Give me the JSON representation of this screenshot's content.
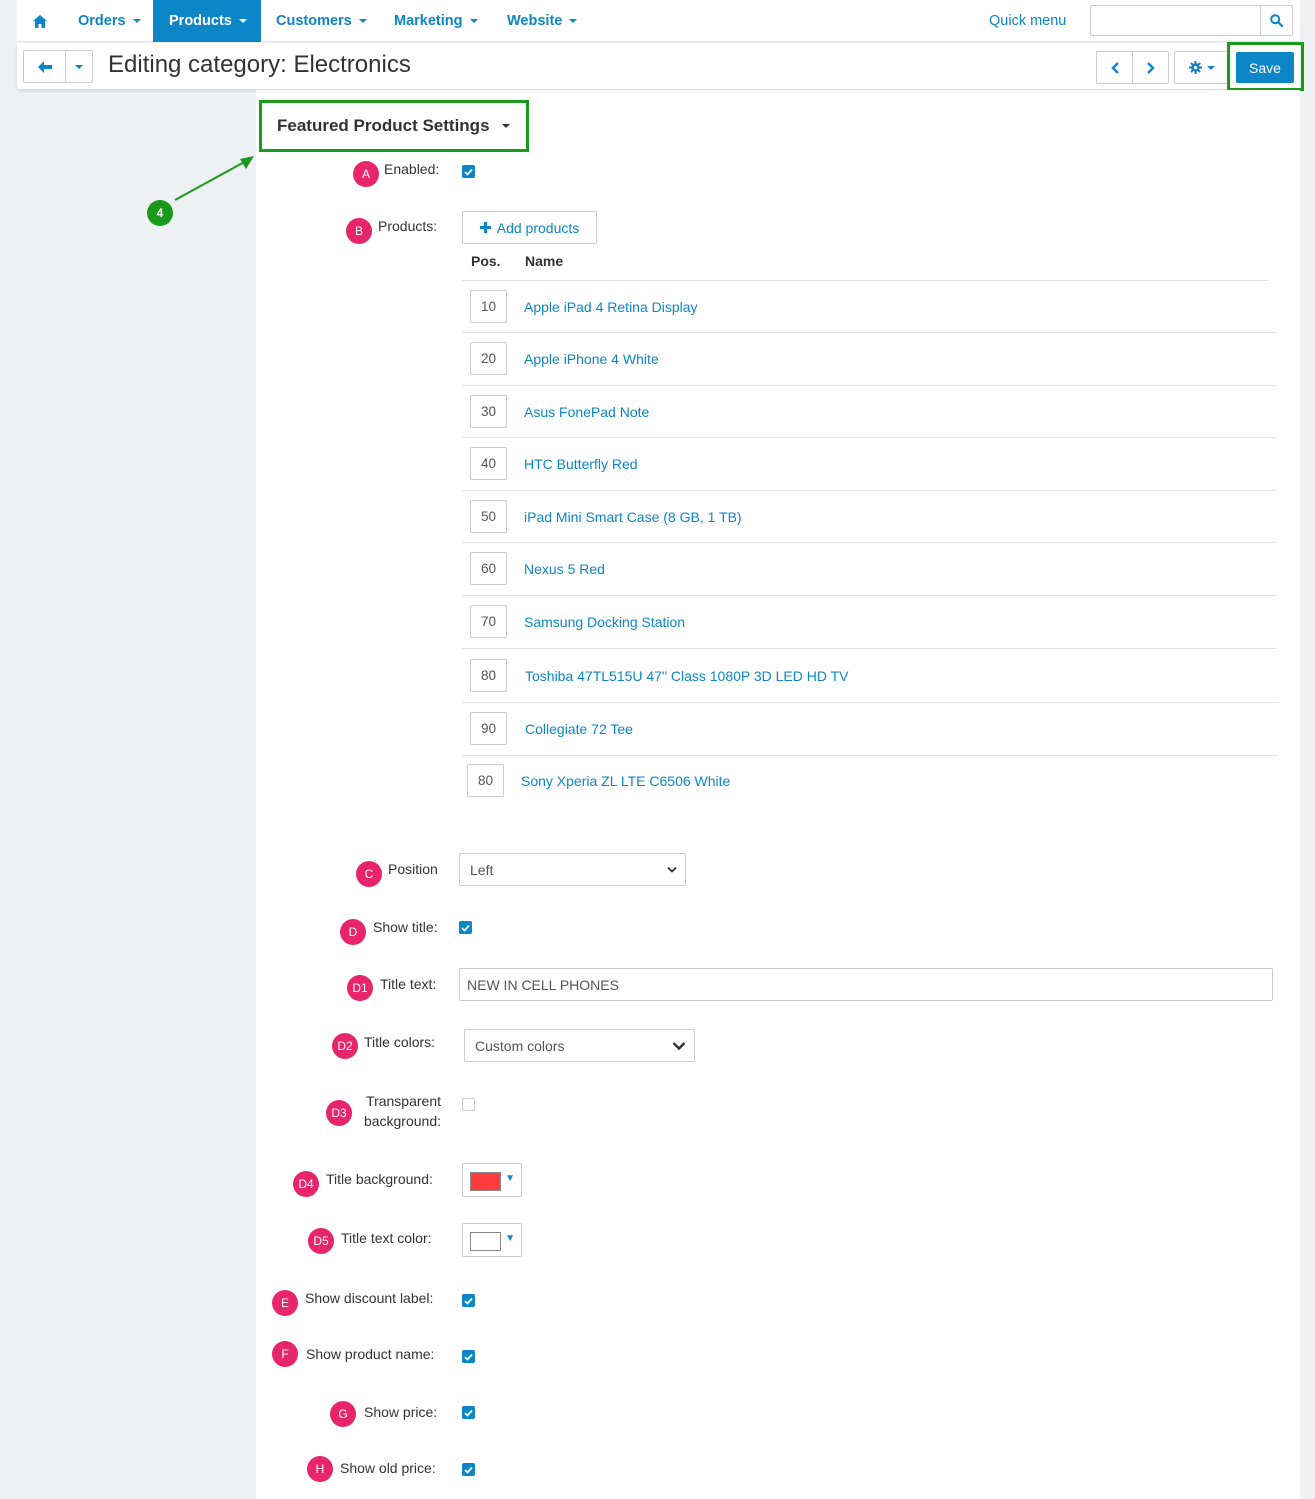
{
  "nav": {
    "items": [
      {
        "label": "Orders",
        "active": false
      },
      {
        "label": "Products",
        "active": true
      },
      {
        "label": "Customers",
        "active": false
      },
      {
        "label": "Marketing",
        "active": false
      },
      {
        "label": "Website",
        "active": false
      }
    ],
    "quick_menu": "Quick menu",
    "search_value": ""
  },
  "toolbar": {
    "title": "Editing category: Electronics",
    "save_label": "Save"
  },
  "section": {
    "title": "Featured Product Settings",
    "step_badge": "4"
  },
  "fields": {
    "enabled": {
      "badge": "A",
      "label": "Enabled:",
      "checked": true
    },
    "products": {
      "badge": "B",
      "label": "Products:",
      "add_label": "Add products"
    },
    "position": {
      "badge": "C",
      "label": "Position",
      "value": "Left"
    },
    "show_title": {
      "badge": "D",
      "label": "Show title:",
      "checked": true
    },
    "title_text": {
      "badge": "D1",
      "label": "Title text:",
      "value": "NEW IN CELL PHONES"
    },
    "title_colors": {
      "badge": "D2",
      "label": "Title colors:",
      "value": "Custom colors"
    },
    "transparent_bg": {
      "badge": "D3",
      "label_line1": "Transparent",
      "label_line2": "background:",
      "checked": false
    },
    "title_bg": {
      "badge": "D4",
      "label": "Title background:",
      "color": "#ff3b3b"
    },
    "title_text_color": {
      "badge": "D5",
      "label": "Title text color:",
      "color": "#ffffff"
    },
    "show_discount": {
      "badge": "E",
      "label": "Show discount label:",
      "checked": true
    },
    "show_name": {
      "badge": "F",
      "label": "Show product name:",
      "checked": true
    },
    "show_price": {
      "badge": "G",
      "label": "Show price:",
      "checked": true
    },
    "show_old_price": {
      "badge": "H",
      "label": "Show old price:",
      "checked": true
    }
  },
  "table": {
    "headers": {
      "pos": "Pos.",
      "name": "Name"
    },
    "rows": [
      {
        "pos": "10",
        "name": "Apple iPad 4 Retina Display"
      },
      {
        "pos": "20",
        "name": "Apple iPhone 4 White"
      },
      {
        "pos": "30",
        "name": "Asus FonePad Note"
      },
      {
        "pos": "40",
        "name": "HTC Butterfly Red"
      },
      {
        "pos": "50",
        "name": "iPad Mini Smart Case (8 GB, 1 TB)"
      },
      {
        "pos": "60",
        "name": "Nexus 5 Red"
      },
      {
        "pos": "70",
        "name": "Samsung Docking Station"
      },
      {
        "pos": "80",
        "name": "Toshiba 47TL515U 47\" Class 1080P 3D LED HD TV"
      },
      {
        "pos": "90",
        "name": "Collegiate 72 Tee"
      },
      {
        "pos": "80",
        "name": "Sony Xperia ZL LTE C6506 White"
      }
    ]
  },
  "colors": {
    "accent": "#0d86c7",
    "highlight": "#1a9a1a",
    "badge": "#e8246a"
  }
}
